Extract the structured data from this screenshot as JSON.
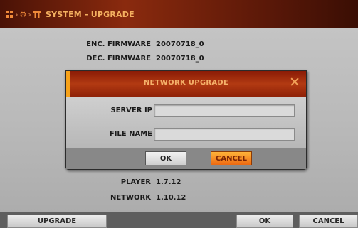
{
  "title_bar": {
    "breadcrumb_icons": [
      "grid-icon",
      "gear-icon",
      "tools-icon"
    ],
    "title": "SYSTEM - UPGRADE"
  },
  "info": {
    "enc_firmware_label": "ENC. FIRMWARE",
    "enc_firmware_value": "20070718_0",
    "dec_firmware_label": "DEC. FIRMWARE",
    "dec_firmware_value": "20070718_0",
    "player_label": "PLAYER",
    "player_value": "1.7.12",
    "network_label": "NETWORK",
    "network_value": "1.10.12"
  },
  "dialog": {
    "title": "NETWORK UPGRADE",
    "server_ip_label": "SERVER IP",
    "server_ip_value": "",
    "file_name_label": "FILE NAME",
    "file_name_value": "",
    "ok_label": "OK",
    "cancel_label": "CANCEL"
  },
  "bottom_bar": {
    "upgrade_label": "UPGRADE",
    "ok_label": "OK",
    "cancel_label": "CANCEL"
  },
  "colors": {
    "title_bar": "#8a2a0e",
    "accent_orange": "#f08a3a",
    "cancel_button": "#ee6a12",
    "background": "#bcbcbc"
  }
}
